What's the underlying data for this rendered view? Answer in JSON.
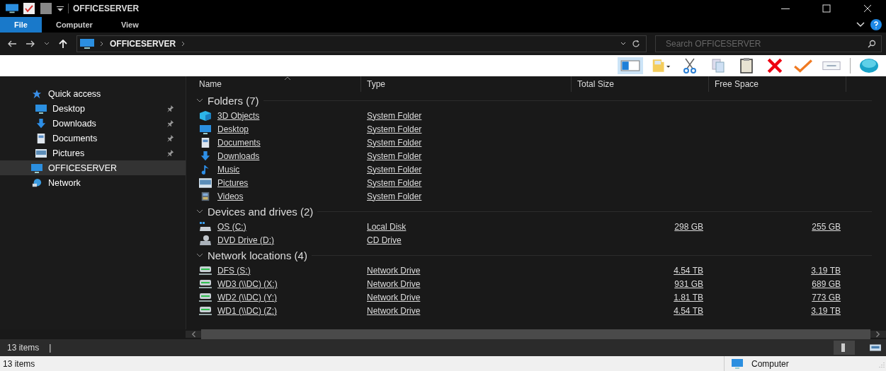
{
  "window": {
    "title": "OFFICESERVER"
  },
  "ribbon_tabs": [
    {
      "label": "File",
      "selected": true
    },
    {
      "label": "Computer",
      "selected": false
    },
    {
      "label": "View",
      "selected": false
    }
  ],
  "address": {
    "path": [
      "OFFICESERVER"
    ],
    "search": {
      "placeholder": "Search OFFICESERVER"
    }
  },
  "sidebar": {
    "items": [
      {
        "label": "Quick access",
        "kind": "star",
        "selected": false,
        "children": [
          {
            "label": "Desktop",
            "kind": "desktop",
            "pinned": true,
            "selected": false
          },
          {
            "label": "Downloads",
            "kind": "downloads",
            "pinned": true,
            "selected": false
          },
          {
            "label": "Documents",
            "kind": "documents",
            "pinned": true,
            "selected": false
          },
          {
            "label": "Pictures",
            "kind": "pictures",
            "pinned": true,
            "selected": false
          }
        ]
      },
      {
        "label": "OFFICESERVER",
        "kind": "computer",
        "selected": true
      },
      {
        "label": "Network",
        "kind": "network",
        "selected": false
      }
    ]
  },
  "columns": [
    "Name",
    "Type",
    "Total Size",
    "Free Space"
  ],
  "groups": [
    {
      "title": "Folders (7)",
      "items": [
        {
          "name": "3D Objects",
          "kind": "objects3d",
          "type": "System Folder"
        },
        {
          "name": "Desktop",
          "kind": "desktop",
          "type": "System Folder"
        },
        {
          "name": "Documents",
          "kind": "documents",
          "type": "System Folder"
        },
        {
          "name": "Downloads",
          "kind": "downloads",
          "type": "System Folder"
        },
        {
          "name": "Music",
          "kind": "music",
          "type": "System Folder"
        },
        {
          "name": "Pictures",
          "kind": "pictures",
          "type": "System Folder"
        },
        {
          "name": "Videos",
          "kind": "videos",
          "type": "System Folder"
        }
      ]
    },
    {
      "title": "Devices and drives (2)",
      "items": [
        {
          "name": "OS (C:)",
          "kind": "disk",
          "type": "Local Disk",
          "total_size": "298 GB",
          "free_space": "255 GB"
        },
        {
          "name": "DVD Drive (D:)",
          "kind": "dvd",
          "type": "CD Drive"
        }
      ]
    },
    {
      "title": "Network locations (4)",
      "items": [
        {
          "name": "DFS (S:)",
          "kind": "netdrive",
          "type": "Network Drive",
          "total_size": "4.54 TB",
          "free_space": "3.19 TB"
        },
        {
          "name": "WD3 (\\\\DC) (X:)",
          "kind": "netdrive",
          "type": "Network Drive",
          "total_size": "931 GB",
          "free_space": "689 GB"
        },
        {
          "name": "WD2 (\\\\DC) (Y:)",
          "kind": "netdrive",
          "type": "Network Drive",
          "total_size": "1.81 TB",
          "free_space": "773 GB"
        },
        {
          "name": "WD1 (\\\\DC) (Z:)",
          "kind": "netdrive",
          "type": "Network Drive",
          "total_size": "4.54 TB",
          "free_space": "3.19 TB"
        }
      ]
    }
  ],
  "status_bar": {
    "count": "13 items",
    "separator": "|"
  },
  "classic_status_bar": {
    "count": "13 items",
    "location": "Computer"
  }
}
